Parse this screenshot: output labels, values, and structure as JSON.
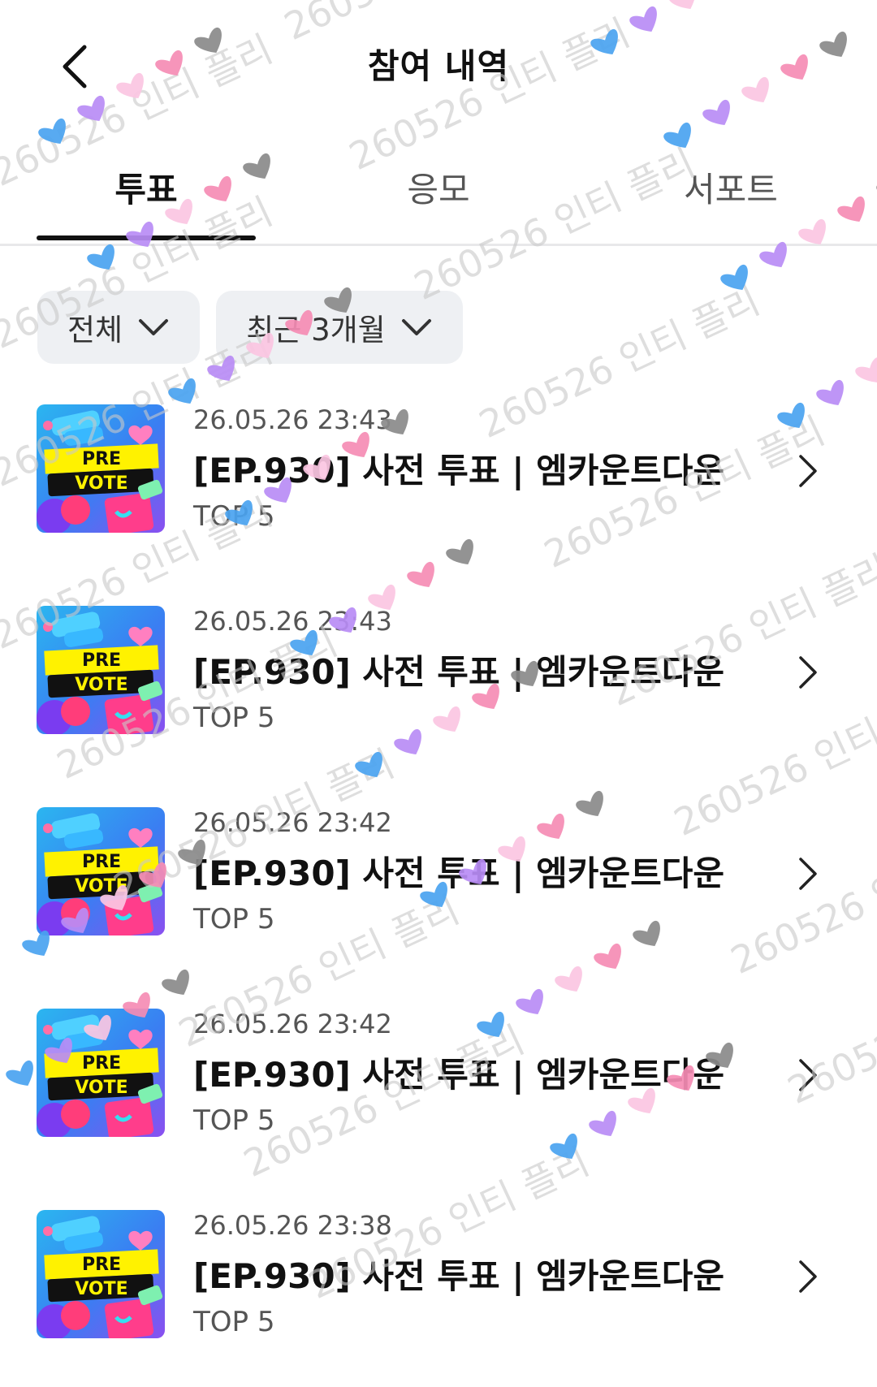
{
  "header": {
    "title": "참여 내역"
  },
  "tabs": [
    {
      "label": "투표",
      "active": true
    },
    {
      "label": "응모",
      "active": false
    },
    {
      "label": "서포트",
      "active": false
    }
  ],
  "filters": {
    "category": "전체",
    "period": "최근 3개월"
  },
  "thumbnail_text": {
    "line1": "PRE",
    "line2": "VOTE"
  },
  "items": [
    {
      "date": "26.05.26 23:43",
      "title": "[EP.930] 사전 투표 | 엠카운트다운",
      "sub": "TOP 5"
    },
    {
      "date": "26.05.26 23:43",
      "title": "[EP.930] 사전 투표 | 엠카운트다운",
      "sub": "TOP 5"
    },
    {
      "date": "26.05.26 23:42",
      "title": "[EP.930] 사전 투표 | 엠카운트다운",
      "sub": "TOP 5"
    },
    {
      "date": "26.05.26 23:42",
      "title": "[EP.930] 사전 투표 | 엠카운트다운",
      "sub": "TOP 5"
    },
    {
      "date": "26.05.26 23:38",
      "title": "[EP.930] 사전 투표 | 엠카운트다운",
      "sub": "TOP 5"
    }
  ],
  "watermark": "260526 인티 플리",
  "colors": {
    "heart_blue": "#4aa3f0",
    "heart_purple": "#b98cf5",
    "heart_pink_light": "#fbc6e2",
    "heart_pink": "#f58cb4",
    "heart_gray": "#8a8a8a"
  }
}
